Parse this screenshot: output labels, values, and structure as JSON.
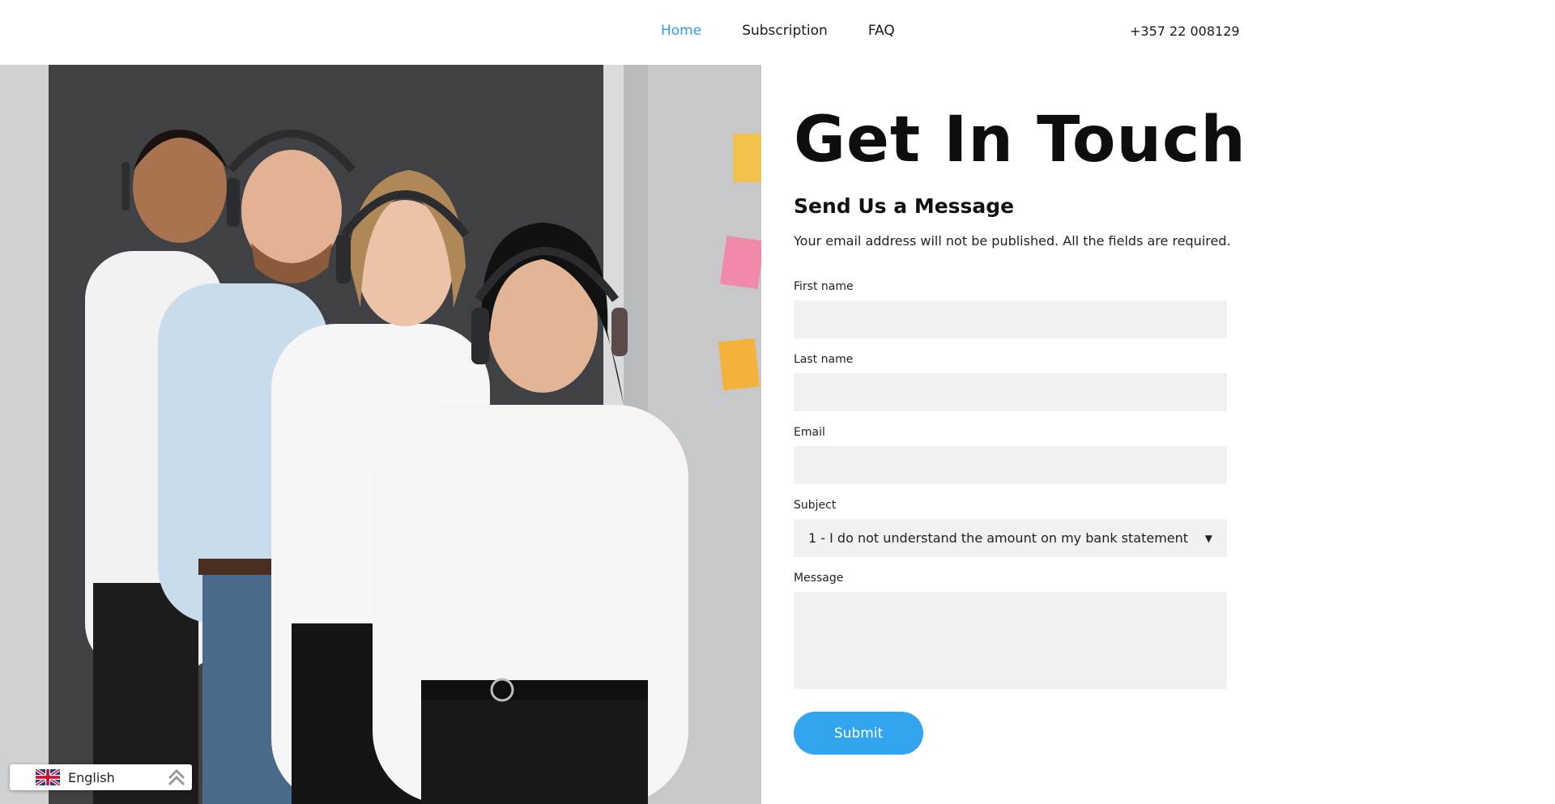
{
  "nav": {
    "items": [
      {
        "label": "Home",
        "active": true
      },
      {
        "label": "Subscription",
        "active": false
      },
      {
        "label": "FAQ",
        "active": false
      }
    ],
    "phone": "+357 22 008129",
    "active_color": "#2f9be6"
  },
  "hero": {
    "image": "customer-support-team-with-headsets"
  },
  "form": {
    "title": "Get In Touch",
    "subtitle": "Send Us a Message",
    "note": "Your email address will not be published. All the fields are required.",
    "first_name_label": "First name",
    "first_name_value": "",
    "last_name_label": "Last name",
    "last_name_value": "",
    "email_label": "Email",
    "email_value": "",
    "subject_label": "Subject",
    "subject_value": "1 - I do not understand the amount on my bank statement",
    "message_label": "Message",
    "message_value": "",
    "submit_label": "Submit",
    "submit_color": "#33a4ef"
  },
  "language": {
    "label": "English",
    "flag": "uk-flag-icon",
    "toggle_icon": "double-chevron-up-icon"
  }
}
